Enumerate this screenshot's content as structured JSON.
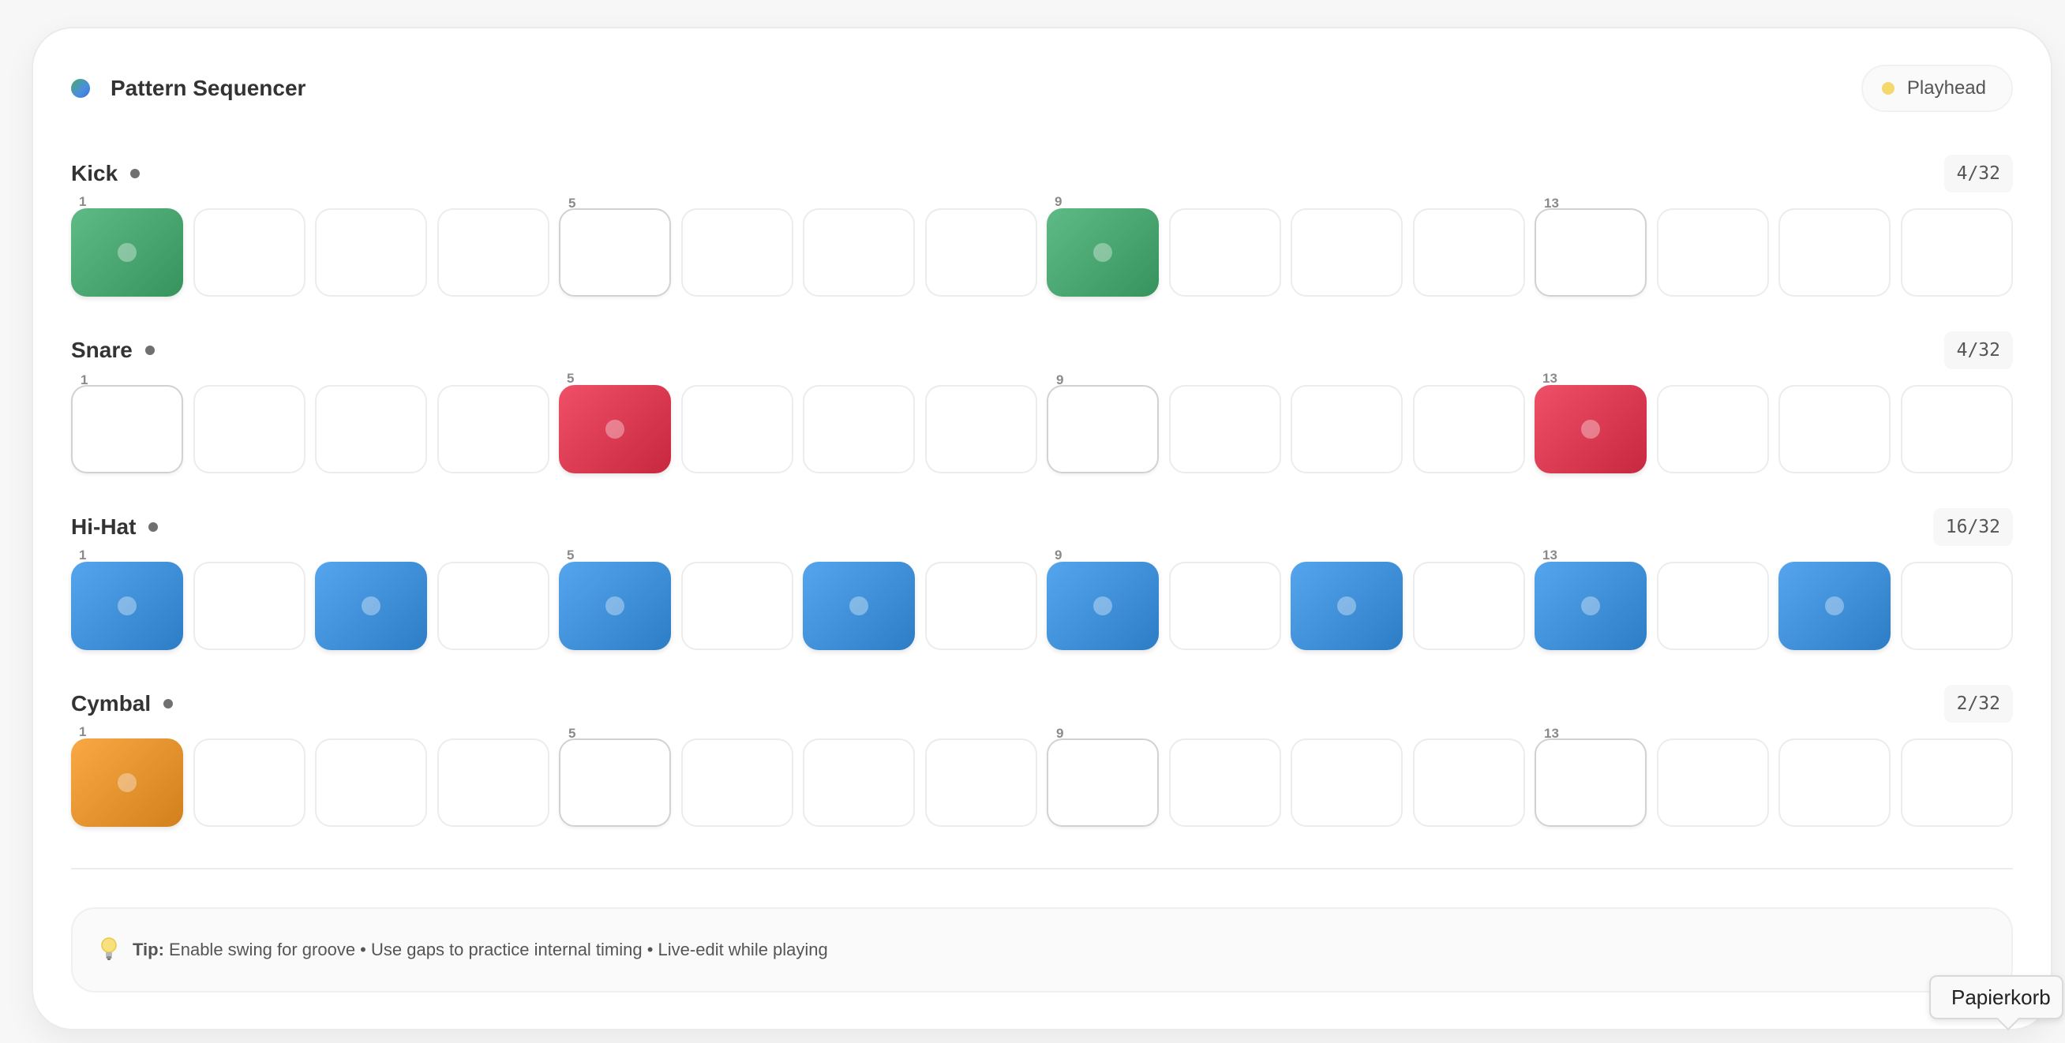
{
  "app": {
    "title": "Pattern Sequencer",
    "playhead_label": "Playhead"
  },
  "colors": {
    "kick": "#49a56f",
    "snare": "#d93a52",
    "hihat": "#3f8fd8",
    "cymbal": "#e3922e",
    "playhead": "#f4d86e"
  },
  "tracks": [
    {
      "name": "Kick",
      "count": "4/32",
      "color_key": "kick",
      "active": [
        1,
        9
      ]
    },
    {
      "name": "Snare",
      "count": "4/32",
      "color_key": "snare",
      "active": [
        5,
        13
      ]
    },
    {
      "name": "Hi-Hat",
      "count": "16/32",
      "color_key": "hihat",
      "active": [
        1,
        3,
        5,
        7,
        9,
        11,
        13,
        15
      ]
    },
    {
      "name": "Cymbal",
      "count": "2/32",
      "color_key": "cymbal",
      "active": [
        1
      ]
    }
  ],
  "step_labels": [
    "1",
    "5",
    "9",
    "13"
  ],
  "tip": {
    "label": "Tip:",
    "text": "Enable swing for groove • Use gaps to practice internal timing • Live-edit while playing"
  },
  "tooltip": {
    "text": "Papierkorb"
  }
}
